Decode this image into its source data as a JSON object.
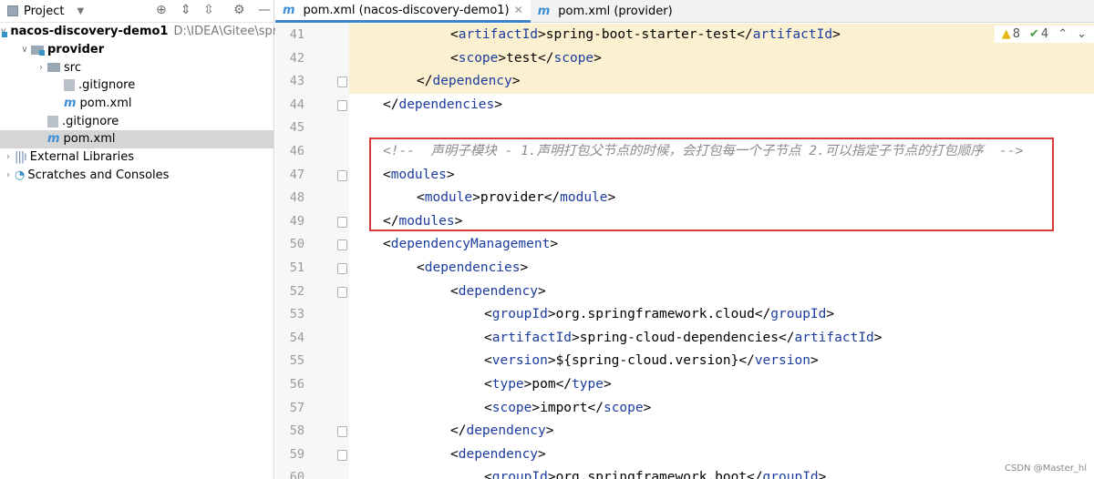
{
  "sidebar": {
    "title": "Project",
    "tree": [
      {
        "label": "nacos-discovery-demo1",
        "path": "D:\\IDEA\\Gitee\\spr",
        "level": 0,
        "arrow": "open",
        "icon": "module-folder",
        "bold": true
      },
      {
        "label": "provider",
        "level": 1,
        "arrow": "open",
        "icon": "module-folder",
        "bold": true
      },
      {
        "label": "src",
        "level": 2,
        "arrow": "closed",
        "icon": "folder"
      },
      {
        "label": ".gitignore",
        "level": 3,
        "icon": "gitignore-file"
      },
      {
        "label": "pom.xml",
        "level": 3,
        "icon": "maven-file"
      },
      {
        "label": ".gitignore",
        "level": 2,
        "icon": "gitignore-file"
      },
      {
        "label": "pom.xml",
        "level": 2,
        "icon": "maven-file",
        "selected": true
      },
      {
        "label": "External Libraries",
        "level": 0,
        "arrow": "closed",
        "icon": "library"
      },
      {
        "label": "Scratches and Consoles",
        "level": 0,
        "arrow": "closed",
        "icon": "scratches"
      }
    ]
  },
  "tabs": [
    {
      "label": "pom.xml (nacos-discovery-demo1)",
      "active": true
    },
    {
      "label": "pom.xml (provider)"
    }
  ],
  "inspections": {
    "warnings": "8",
    "typos": "4"
  },
  "editor": {
    "lines": [
      {
        "n": "41",
        "indent": 3,
        "text": "<artifactId>spring-boot-starter-test</artifactId>",
        "hl": true
      },
      {
        "n": "42",
        "indent": 3,
        "text": "<scope>test</scope>",
        "hl": true
      },
      {
        "n": "43",
        "indent": 2,
        "text": "</dependency>",
        "hl": true,
        "fold": true
      },
      {
        "n": "44",
        "indent": 1,
        "text": "</dependencies>",
        "fold": true
      },
      {
        "n": "45",
        "indent": 0,
        "text": ""
      },
      {
        "n": "46",
        "indent": 1,
        "text": "<!--  声明子模块 - 1.声明打包父节点的时候，会打包每一个子节点 2.可以指定子节点的打包顺序  -->",
        "comment": true
      },
      {
        "n": "47",
        "indent": 1,
        "text": "<modules>",
        "fold": true
      },
      {
        "n": "48",
        "indent": 2,
        "text": "<module>provider</module>"
      },
      {
        "n": "49",
        "indent": 1,
        "text": "</modules>",
        "fold": true
      },
      {
        "n": "50",
        "indent": 1,
        "text": "<dependencyManagement>",
        "fold": true
      },
      {
        "n": "51",
        "indent": 2,
        "text": "<dependencies>",
        "fold": true
      },
      {
        "n": "52",
        "indent": 3,
        "text": "<dependency>",
        "fold": true
      },
      {
        "n": "53",
        "indent": 4,
        "text": "<groupId>org.springframework.cloud</groupId>"
      },
      {
        "n": "54",
        "indent": 4,
        "text": "<artifactId>spring-cloud-dependencies</artifactId>"
      },
      {
        "n": "55",
        "indent": 4,
        "text": "<version>${spring-cloud.version}</version>"
      },
      {
        "n": "56",
        "indent": 4,
        "text": "<type>pom</type>"
      },
      {
        "n": "57",
        "indent": 4,
        "text": "<scope>import</scope>"
      },
      {
        "n": "58",
        "indent": 3,
        "text": "</dependency>",
        "fold": true
      },
      {
        "n": "59",
        "indent": 3,
        "text": "<dependency>",
        "fold": true
      },
      {
        "n": "60",
        "indent": 4,
        "text": "<groupId>org.springframework.boot</groupId>"
      }
    ]
  },
  "watermark": "CSDN @Master_hl"
}
